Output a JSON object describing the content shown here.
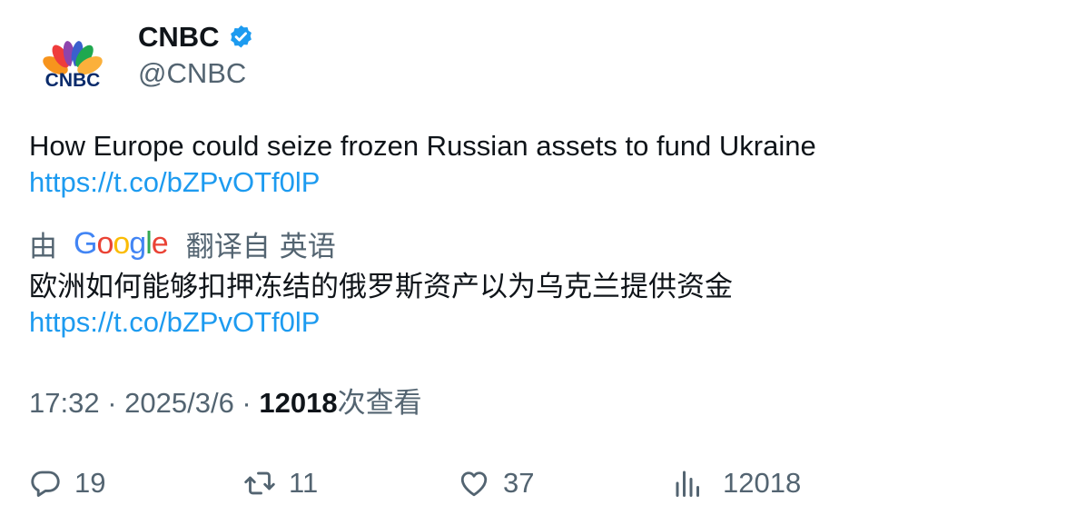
{
  "author": {
    "display_name": "CNBC",
    "handle": "@CNBC",
    "verified_icon": "verified-badge-icon",
    "avatar_logo_text": "CNBC",
    "colors": {
      "verified": "#1d9bf0",
      "peacock": [
        "#fbb03b",
        "#ef3c3c",
        "#8e44ad",
        "#3a5fcd",
        "#1fa84f",
        "#f7941d"
      ],
      "logo_text": "#0a2b6b"
    }
  },
  "tweet": {
    "text": "How Europe could seize frozen Russian assets to fund Ukraine",
    "link": "https://t.co/bZPvOTf0lP"
  },
  "translation": {
    "by_label": "由",
    "provider": "Google",
    "translated_from_label": "翻译自",
    "source_language": "英语",
    "text": "欧洲如何能够扣押冻结的俄罗斯资产以为乌克兰提供资金",
    "link": "https://t.co/bZPvOTf0lP"
  },
  "meta": {
    "time": "17:32",
    "separator": " · ",
    "date": "2025/3/6",
    "views": "12018",
    "views_label": "次查看"
  },
  "actions": {
    "replies": "19",
    "retweets": "11",
    "likes": "37",
    "views": "12018",
    "icons": [
      "reply-icon",
      "retweet-icon",
      "like-icon",
      "views-icon"
    ]
  },
  "colors": {
    "text_primary": "#0f1419",
    "text_secondary": "#536471",
    "link": "#1d9bf0"
  }
}
